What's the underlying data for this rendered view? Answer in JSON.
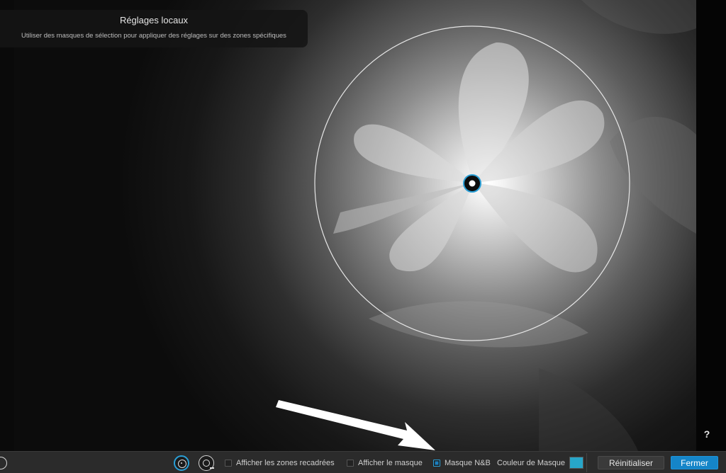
{
  "panel": {
    "title": "Réglages locaux",
    "subtitle": "Utiliser des masques de sélection pour appliquer des réglages sur des zones spécifiques"
  },
  "help": {
    "label": "?"
  },
  "toolbar": {
    "left_tool_icon": "circle-half-icon",
    "radial_tool_icon": "radial-selection-icon",
    "remove_tool_icon": "radial-remove-icon",
    "show_cropped_label": "Afficher les zones recadrées",
    "show_cropped_checked": false,
    "show_mask_label": "Afficher le masque",
    "show_mask_checked": false,
    "bw_mask_label": "Masque N&B",
    "bw_mask_checked": true,
    "mask_color_label": "Couleur de Masque",
    "mask_color": "#27a6c9",
    "reset_label": "Réinitialiser",
    "close_label": "Fermer"
  },
  "colors": {
    "accent": "#1585c8"
  }
}
